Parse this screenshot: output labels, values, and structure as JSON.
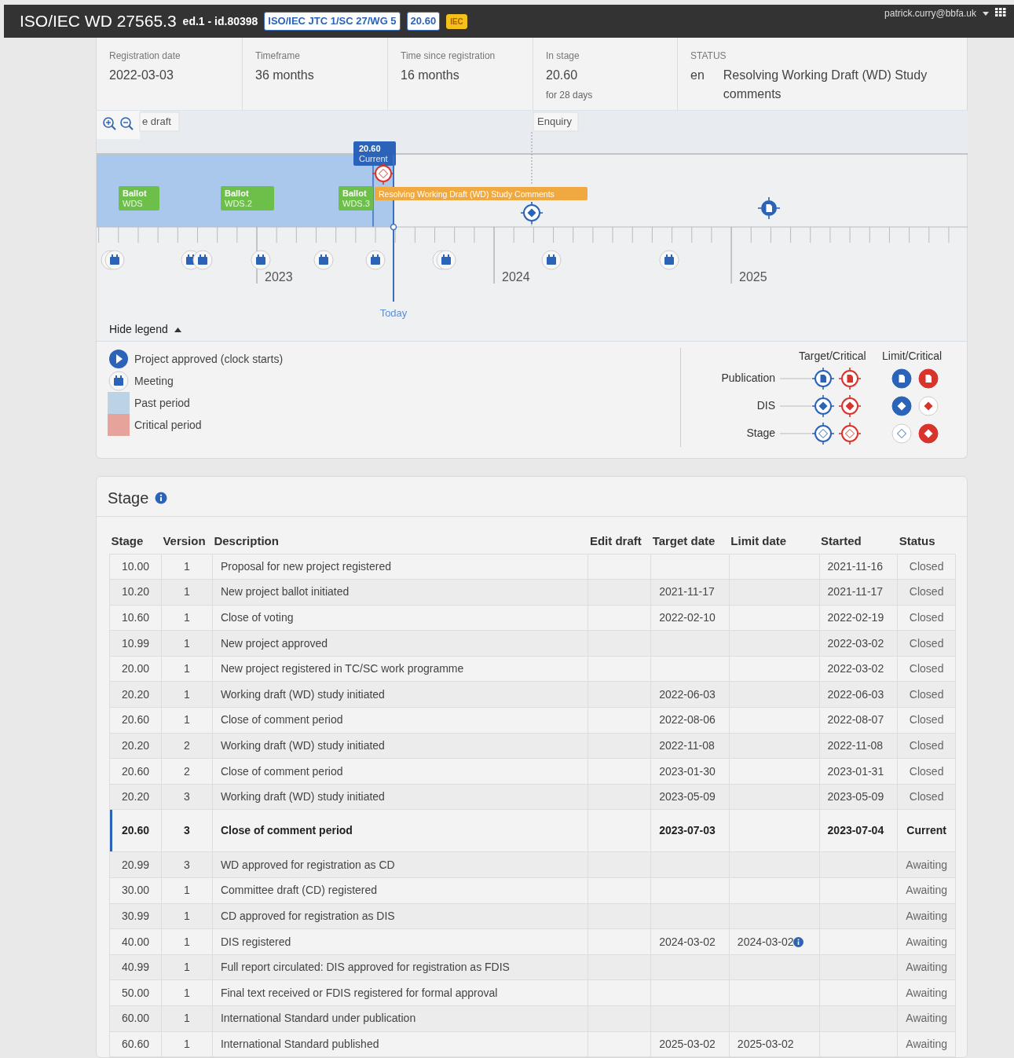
{
  "header": {
    "title": "ISO/IEC WD 27565.3",
    "edition": "ed.1 - id.80398",
    "badges": [
      {
        "text": "ISO/IEC JTC 1/SC 27/WG 5",
        "kind": "committee"
      },
      {
        "text": "20.60",
        "kind": "stage"
      },
      {
        "text": "IEC",
        "kind": "org"
      }
    ],
    "user": "patrick.curry@bbfa.uk"
  },
  "summary": [
    {
      "label": "Registration date",
      "value": "2022-03-03"
    },
    {
      "label": "Timeframe",
      "value": "36 months"
    },
    {
      "label": "Time since registration",
      "value": "16 months"
    },
    {
      "label": "In stage",
      "value": "20.60",
      "note": "for 28 days"
    }
  ],
  "status": {
    "label": "STATUS",
    "language": "en",
    "text": "Resolving Working Draft (WD) Study comments"
  },
  "timeline": {
    "phases": [
      "e draft",
      "Enquiry"
    ],
    "current": {
      "stage": "20.60",
      "label": "Current"
    },
    "ballots": [
      {
        "title": "Ballot",
        "code": "WDS"
      },
      {
        "title": "Ballot",
        "code": "WDS.2"
      },
      {
        "title": "Ballot",
        "code": "WDS.3"
      }
    ],
    "stage_label": "Resolving Working Draft (WD) Study Comments",
    "years": [
      "2023",
      "2024",
      "2025"
    ],
    "today": "Today"
  },
  "legend_toggle": {
    "label": "Hide legend",
    "expanded": true
  },
  "legend": {
    "items": [
      {
        "kind": "approved",
        "label": "Project approved (clock starts)"
      },
      {
        "kind": "meeting",
        "label": "Meeting"
      },
      {
        "kind": "past",
        "label": "Past period"
      },
      {
        "kind": "critical",
        "label": "Critical period"
      }
    ],
    "columns": [
      "Target/Critical",
      "Limit/Critical"
    ],
    "rows": [
      {
        "kind": "publication",
        "label": "Publication"
      },
      {
        "kind": "dis",
        "label": "DIS"
      },
      {
        "kind": "stage",
        "label": "Stage"
      }
    ]
  },
  "stage_table": {
    "title": "Stage",
    "columns": [
      "Stage",
      "Version",
      "Description",
      "Edit draft",
      "Target date",
      "Limit date",
      "Started",
      "Status"
    ],
    "rows": [
      {
        "cells": [
          "10.00",
          "1",
          "Proposal for new project registered",
          "",
          "",
          "",
          "2021-11-16",
          "Closed"
        ],
        "current": false,
        "limit_info": false
      },
      {
        "cells": [
          "10.20",
          "1",
          "New project ballot initiated",
          "",
          "2021-11-17",
          "",
          "2021-11-17",
          "Closed"
        ],
        "current": false,
        "limit_info": false
      },
      {
        "cells": [
          "10.60",
          "1",
          "Close of voting",
          "",
          "2022-02-10",
          "",
          "2022-02-19",
          "Closed"
        ],
        "current": false,
        "limit_info": false
      },
      {
        "cells": [
          "10.99",
          "1",
          "New project approved",
          "",
          "",
          "",
          "2022-03-02",
          "Closed"
        ],
        "current": false,
        "limit_info": false
      },
      {
        "cells": [
          "20.00",
          "1",
          "New project registered in TC/SC work programme",
          "",
          "",
          "",
          "2022-03-02",
          "Closed"
        ],
        "current": false,
        "limit_info": false
      },
      {
        "cells": [
          "20.20",
          "1",
          "Working draft (WD) study initiated",
          "",
          "2022-06-03",
          "",
          "2022-06-03",
          "Closed"
        ],
        "current": false,
        "limit_info": false
      },
      {
        "cells": [
          "20.60",
          "1",
          "Close of comment period",
          "",
          "2022-08-06",
          "",
          "2022-08-07",
          "Closed"
        ],
        "current": false,
        "limit_info": false
      },
      {
        "cells": [
          "20.20",
          "2",
          "Working draft (WD) study initiated",
          "",
          "2022-11-08",
          "",
          "2022-11-08",
          "Closed"
        ],
        "current": false,
        "limit_info": false
      },
      {
        "cells": [
          "20.60",
          "2",
          "Close of comment period",
          "",
          "2023-01-30",
          "",
          "2023-01-31",
          "Closed"
        ],
        "current": false,
        "limit_info": false
      },
      {
        "cells": [
          "20.20",
          "3",
          "Working draft (WD) study initiated",
          "",
          "2023-05-09",
          "",
          "2023-05-09",
          "Closed"
        ],
        "current": false,
        "limit_info": false
      },
      {
        "cells": [
          "20.60",
          "3",
          "Close of comment period",
          "",
          "2023-07-03",
          "",
          "2023-07-04",
          "Current"
        ],
        "current": true,
        "limit_info": false
      },
      {
        "cells": [
          "20.99",
          "3",
          "WD approved for registration as CD",
          "",
          "",
          "",
          "",
          "Awaiting"
        ],
        "current": false,
        "limit_info": false
      },
      {
        "cells": [
          "30.00",
          "1",
          "Committee draft (CD) registered",
          "",
          "",
          "",
          "",
          "Awaiting"
        ],
        "current": false,
        "limit_info": false
      },
      {
        "cells": [
          "30.99",
          "1",
          "CD approved for registration as DIS",
          "",
          "",
          "",
          "",
          "Awaiting"
        ],
        "current": false,
        "limit_info": false
      },
      {
        "cells": [
          "40.00",
          "1",
          "DIS registered",
          "",
          "2024-03-02",
          "2024-03-02",
          "",
          "Awaiting"
        ],
        "current": false,
        "limit_info": true
      },
      {
        "cells": [
          "40.99",
          "1",
          "Full report circulated: DIS approved for registration as FDIS",
          "",
          "",
          "",
          "",
          "Awaiting"
        ],
        "current": false,
        "limit_info": false
      },
      {
        "cells": [
          "50.00",
          "1",
          "Final text received or FDIS registered for formal approval",
          "",
          "",
          "",
          "",
          "Awaiting"
        ],
        "current": false,
        "limit_info": false
      },
      {
        "cells": [
          "60.00",
          "1",
          "International Standard under publication",
          "",
          "",
          "",
          "",
          "Awaiting"
        ],
        "current": false,
        "limit_info": false
      },
      {
        "cells": [
          "60.60",
          "1",
          "International Standard published",
          "",
          "2025-03-02",
          "2025-03-02",
          "",
          "Awaiting"
        ],
        "current": false,
        "limit_info": false
      }
    ]
  }
}
